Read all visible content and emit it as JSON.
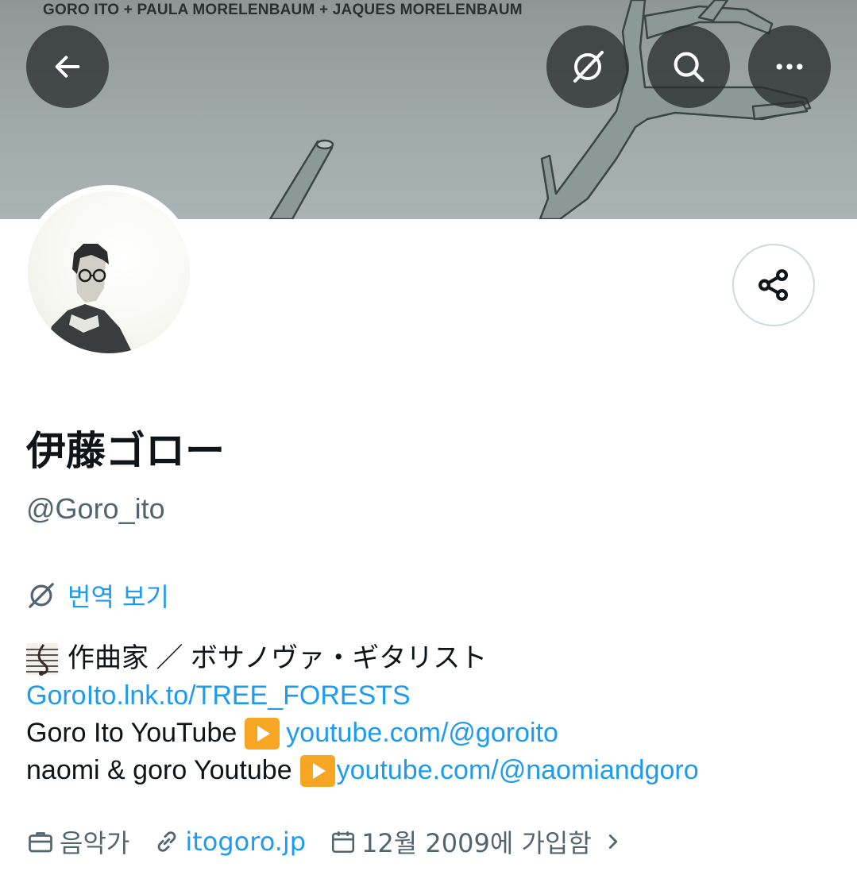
{
  "banner": {
    "credits": "GORO ITO + PAULA MORELENBAUM + JAQUES MORELENBAUM"
  },
  "toolbar": {
    "back_icon": "arrow-left-icon",
    "translate_icon": "no-translate-icon",
    "search_icon": "search-icon",
    "more_icon": "more-horizontal-icon"
  },
  "profile": {
    "display_name": "伊藤ゴロー",
    "handle": "@Goro_ito",
    "translate_label": "번역 보기",
    "share_icon": "share-icon"
  },
  "bio": {
    "line1_emoji": "musical-score-icon",
    "line1_text": "作曲家 ／ ボサノヴァ・ギタリスト",
    "line2_link": "GoroIto.lnk.to/TREE_FORESTS",
    "line3_text": "Goro Ito YouTube ",
    "line3_link": "youtube.com/@goroito",
    "line4_text": "naomi & goro Youtube ",
    "line4_link": "youtube.com/@naomiandgoro"
  },
  "meta": {
    "category": "음악가",
    "website": "itogoro.jp",
    "joined": "12월 2009에 가입함"
  },
  "colors": {
    "accent": "#1d9bf0",
    "secondary_text": "#536471",
    "primary_text": "#0f1419",
    "play_badge": "#f6a623"
  }
}
